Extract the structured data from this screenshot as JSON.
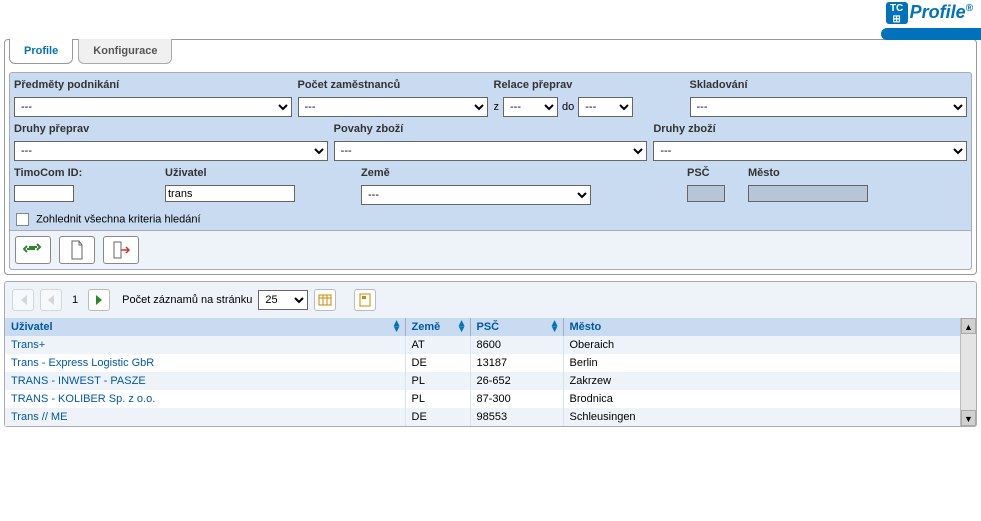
{
  "logo_text": "Profile",
  "tabs": {
    "profile": "Profile",
    "config": "Konfigurace"
  },
  "filters": {
    "predmety_label": "Předměty podnikání",
    "pocet_label": "Počet zaměstnanců",
    "relace_label": "Relace přeprav",
    "relace_z": "z",
    "relace_do": "do",
    "skladovani_label": "Skladování",
    "druhy_preprav_label": "Druhy přeprav",
    "povahy_label": "Povahy zboží",
    "druhy_zbozi_label": "Druhy zboží",
    "dash": "---",
    "dash_wide": "--- ",
    "timocom_label": "TimoCom ID:",
    "uzivatel_label": "Uživatel",
    "uzivatel_value": "trans",
    "zeme_label": "Země",
    "psc_label": "PSČ",
    "mesto_label": "Město",
    "zohlednit": "Zohlednit všechna kriteria hledání"
  },
  "pager": {
    "page": "1",
    "records_label": "Počet záznamů na stránku",
    "per_page": "25"
  },
  "table": {
    "headers": {
      "uzivatel": "Uživatel",
      "zeme": "Země",
      "psc": "PSČ",
      "mesto": "Město"
    },
    "rows": [
      {
        "u": "Trans+",
        "z": "AT",
        "p": "8600",
        "m": "Oberaich"
      },
      {
        "u": "Trans - Express Logistic GbR",
        "z": "DE",
        "p": "13187",
        "m": "Berlin"
      },
      {
        "u": "TRANS - INWEST - PASZE",
        "z": "PL",
        "p": "26-652",
        "m": "Zakrzew"
      },
      {
        "u": "TRANS - KOLIBER Sp. z o.o.",
        "z": "PL",
        "p": "87-300",
        "m": "Brodnica"
      },
      {
        "u": "Trans // ME",
        "z": "DE",
        "p": "98553",
        "m": "Schleusingen"
      }
    ]
  }
}
